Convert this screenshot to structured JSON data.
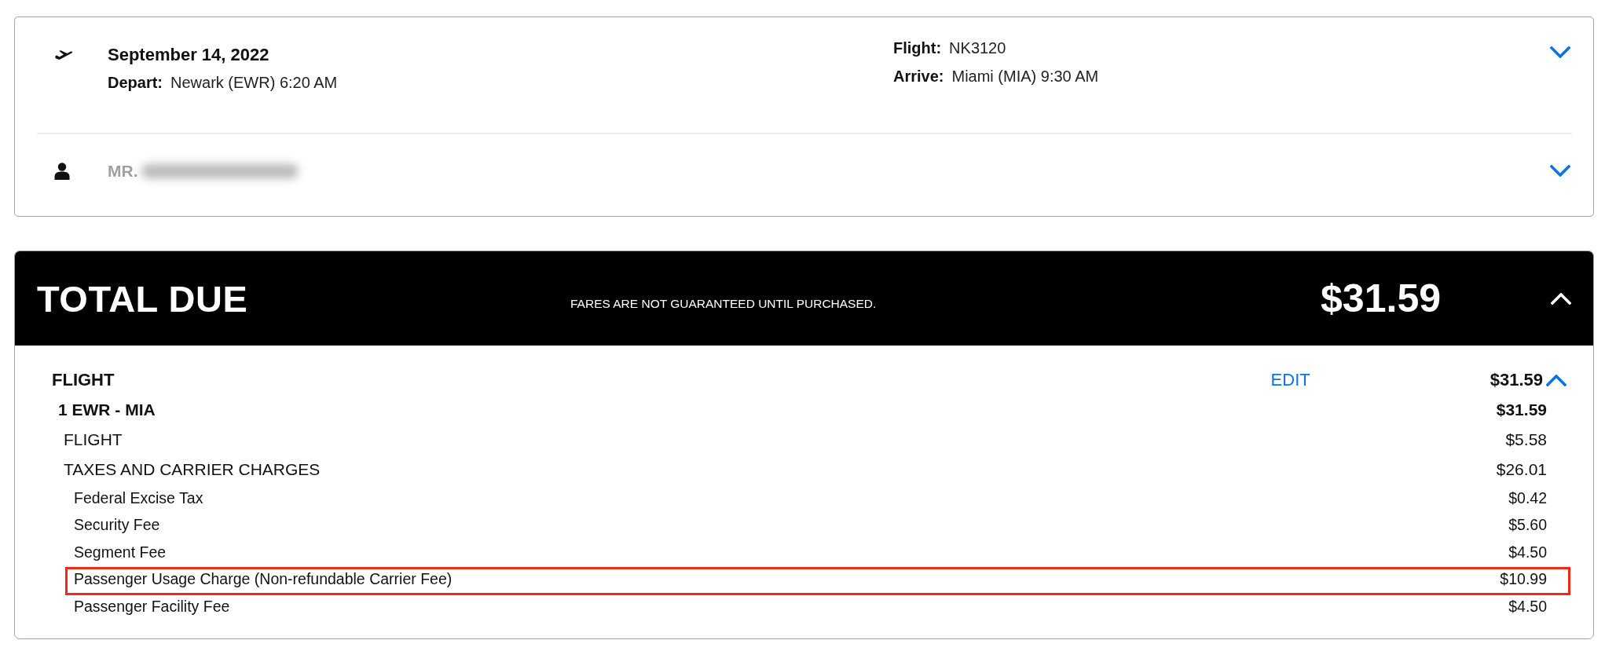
{
  "itinerary": {
    "date": "September 14, 2022",
    "depart": {
      "label": "Depart:",
      "value": "Newark (EWR) 6:20 AM"
    },
    "flight": {
      "label": "Flight:",
      "value": "NK3120"
    },
    "arrive": {
      "label": "Arrive:",
      "value": "Miami (MIA) 9:30 AM"
    },
    "expanded": false
  },
  "passenger": {
    "name": "MR.",
    "expanded": false
  },
  "total_due": {
    "title": "TOTAL DUE",
    "notice": "FARES ARE NOT GUARANTEED UNTIL PURCHASED.",
    "amount": "$31.59",
    "expanded": true
  },
  "breakdown": {
    "section": {
      "label": "FLIGHT",
      "edit": "EDIT",
      "amount": "$31.59",
      "expanded": true
    },
    "lines": [
      {
        "label": "1 EWR - MIA",
        "amount": "$31.59",
        "children": [
          {
            "label": "FLIGHT",
            "amount": "$5.58"
          },
          {
            "label": "TAXES AND CARRIER CHARGES",
            "amount": "$26.01",
            "children": [
              {
                "label": "Federal Excise Tax",
                "amount": "$0.42",
                "highlighted": false
              },
              {
                "label": "Security Fee",
                "amount": "$5.60",
                "highlighted": false
              },
              {
                "label": "Segment Fee",
                "amount": "$4.50",
                "highlighted": false
              },
              {
                "label": "Passenger Usage Charge (Non-refundable Carrier Fee)",
                "amount": "$10.99",
                "highlighted": true
              },
              {
                "label": "Passenger Facility Fee",
                "amount": "$4.50",
                "highlighted": false
              }
            ]
          }
        ]
      }
    ]
  }
}
